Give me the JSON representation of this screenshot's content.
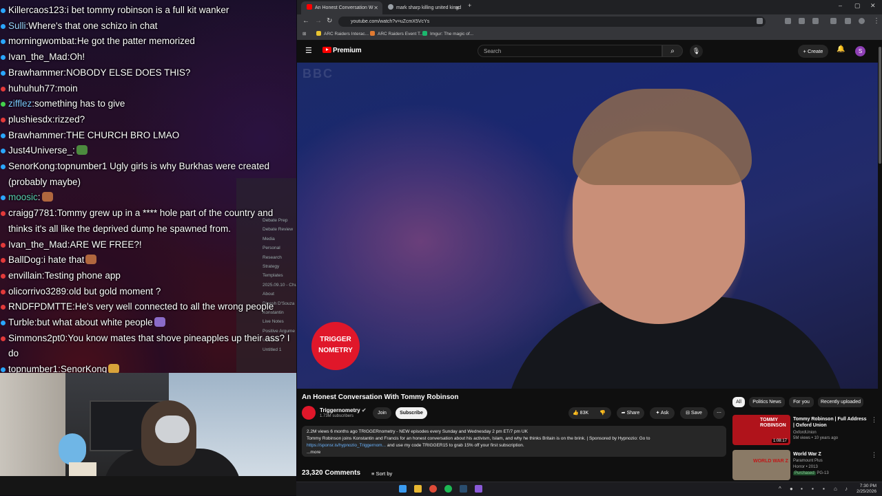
{
  "chat": {
    "messages": [
      {
        "user": "Killercaos123",
        "text": "i bet tommy robinson is a full kit wanker",
        "color": "#ffffff",
        "dot": "#2aa7ff"
      },
      {
        "user": "Sulli",
        "text": "Where's that one schizo in chat",
        "color": "#9ad7ff",
        "dot": "#2aa7ff"
      },
      {
        "user": "morningwombat",
        "text": "He got the patter memorized",
        "color": "#ffffff",
        "dot": "#2aa7ff"
      },
      {
        "user": "Ivan_the_Mad",
        "text": "Oh!",
        "color": "#ffffff",
        "dot": "#2aa7ff"
      },
      {
        "user": "Brawhammer",
        "text": "NOBODY ELSE DOES THIS?",
        "color": "#ffffff",
        "dot": "#2aa7ff"
      },
      {
        "user": "huhuhuh77",
        "text": "moin",
        "color": "#ffffff",
        "dot": "#e23a3a"
      },
      {
        "user": "zifflez",
        "text": "something has to give",
        "color": "#7ec8ff",
        "dot": "#43d14b"
      },
      {
        "user": "plushiesdx",
        "text": "rizzed?",
        "color": "#ffffff",
        "dot": "#e23a3a"
      },
      {
        "user": "Brawhammer",
        "text": "THE CHURCH BRO LMAO",
        "color": "#ffffff",
        "dot": "#2aa7ff"
      },
      {
        "user": "Just4Universe_",
        "text": "",
        "color": "#ffffff",
        "dot": "#2aa7ff",
        "emote": "#4c8a3e"
      },
      {
        "user": "SenorKong",
        "text": "topnumber1 Ugly girls is why Burkhas were created (probably maybe)",
        "color": "#ffffff",
        "dot": "#2aa7ff",
        "wrap": true
      },
      {
        "user": "moosic",
        "text": "",
        "color": "#58d0b0",
        "dot": "#2aa7ff",
        "emote": "#b0673e"
      },
      {
        "user": "craigg7781",
        "text": "Tommy grew up in a **** hole part of the country and thinks it's all like the deprived dump he spawned from.",
        "color": "#ffffff",
        "dot": "#e23a3a",
        "wrap": true
      },
      {
        "user": "Ivan_the_Mad",
        "text": "ARE WE FREE?!",
        "color": "#ffffff",
        "dot": "#e23a3a"
      },
      {
        "user": "BallDog",
        "text": "i hate that",
        "color": "#ffffff",
        "dot": "#e23a3a",
        "emote": "#b0673e"
      },
      {
        "user": "envillain",
        "text": "Testing phone app",
        "color": "#ffffff",
        "dot": "#e23a3a"
      },
      {
        "user": "olicorrivo3289",
        "text": "old but gold moment ?",
        "color": "#ffffff",
        "dot": "#e23a3a"
      },
      {
        "user": "RNDFPDMTTE",
        "text": "He's very well connected to all the wrong people",
        "color": "#ffffff",
        "dot": "#e23a3a"
      },
      {
        "user": "Turble",
        "text": "but what about white people",
        "color": "#ffffff",
        "dot": "#2aa7ff",
        "emote": "#8a6bc8"
      },
      {
        "user": "Simmons2pt0",
        "text": "You know mates that shove pineapples up their ass? I do",
        "color": "#ffffff",
        "dot": "#e23a3a",
        "wrap": true
      },
      {
        "user": "topnumber1",
        "text": "SenorKong",
        "color": "#ffffff",
        "dot": "#2aa7ff",
        "emote": "#d9a33a"
      }
    ],
    "ghost_panel": [
      "Debate Prep",
      "Debate Review",
      "Media",
      "Personal",
      "Research",
      "Strategy",
      "Templates",
      "2025.09.10 - Chu",
      "About",
      "Dinesh D'Souza",
      "Konstantin",
      "Live Notes",
      "Positive Argume",
      "Untitled",
      "Untitled 1"
    ]
  },
  "browser": {
    "tabs": [
      {
        "label": "An Honest Conversation W",
        "active": true
      },
      {
        "label": "mark sharp killing united kingd",
        "active": false
      }
    ],
    "url": "youtube.com/watch?v=uZcmX5VcYs",
    "bookmarks": [
      "ARC Raiders Interac...",
      "ARC Raiders Event T...",
      "Imgur: The magic of..."
    ]
  },
  "youtube": {
    "logo_text": "Premium",
    "search_placeholder": "Search",
    "create_label": "Create",
    "avatar_letter": "S",
    "watermark": "BBC",
    "trigger_line1": "TRIGGER",
    "trigger_line2": "NOMETRY",
    "video_title": "An Honest Conversation With Tommy Robinson",
    "channel_name": "Triggernometry",
    "channel_subs": "1.73M subscribers",
    "join_label": "Join",
    "subscribe_label": "Subscribe",
    "likes": "83K",
    "share_label": "Share",
    "ask_label": "Ask",
    "save_label": "Save",
    "desc_line1": "2.2M views  6 months ago  TRIGGERnometry - NEW episodes every Sunday and Wednesday 2 pm ET/7 pm UK",
    "desc_line2": "Tommy Robinson joins Konstantin and Francis for an honest conversation about his activism, Islam, and why he thinks Britain is on the brink. | Sponsored by Hypnozio: Go to",
    "desc_link": "https://sponsr.is/hypnozio_Triggernom...",
    "desc_line3": " and use my code TRIGGER15 to grab 15% off your first subscription.",
    "desc_more": "...more",
    "comments_count": "23,320 Comments",
    "sort_label": "Sort by",
    "chips": [
      "All",
      "Politics News",
      "For you",
      "Recently uploaded"
    ],
    "recs": [
      {
        "title": "Tommy Robinson | Full Address | Oxford Union",
        "channel": "OxfordUnion",
        "meta": "5M views • 10 years ago",
        "duration": "1:08:17",
        "thumb_label": "TOMMY ROBINSON",
        "thumb_color": "#b0131b"
      },
      {
        "title": "World War Z",
        "channel": "Paramount Plus",
        "meta": "Horror • 2013",
        "duration": "",
        "thumb_label": "WORLD WAR Z",
        "thumb_color": "#8a7a66",
        "badge": "Purchased",
        "rating": "PG-13"
      }
    ]
  },
  "taskbar": {
    "time": "7:30 PM",
    "date": "2/25/2026"
  }
}
